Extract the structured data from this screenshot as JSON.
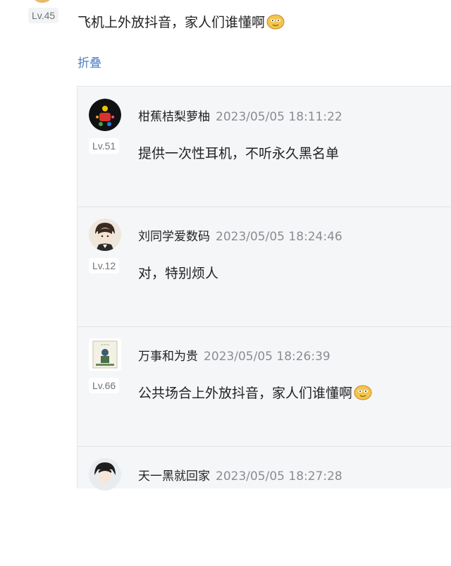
{
  "top_comment": {
    "level": "Lv.45",
    "text": "飞机上外放抖音，家人们谁懂啊",
    "emoji": "doge-emoji"
  },
  "fold_label": "折叠",
  "replies": [
    {
      "name": "柑蕉桔梨萝柚",
      "time": "2023/05/05 18:11:22",
      "level": "Lv.51",
      "text": "提供一次性耳机，不听永久黑名单"
    },
    {
      "name": "刘同学爱数码",
      "time": "2023/05/05 18:24:46",
      "level": "Lv.12",
      "text": "对，特别烦人"
    },
    {
      "name": "万事和为贵",
      "time": "2023/05/05 18:26:39",
      "level": "Lv.66",
      "text": "公共场合上外放抖音，家人们谁懂啊",
      "emoji": "doge-emoji"
    },
    {
      "name": "天一黑就回家",
      "time": "2023/05/05 18:27:28",
      "level": "",
      "text": ""
    }
  ]
}
